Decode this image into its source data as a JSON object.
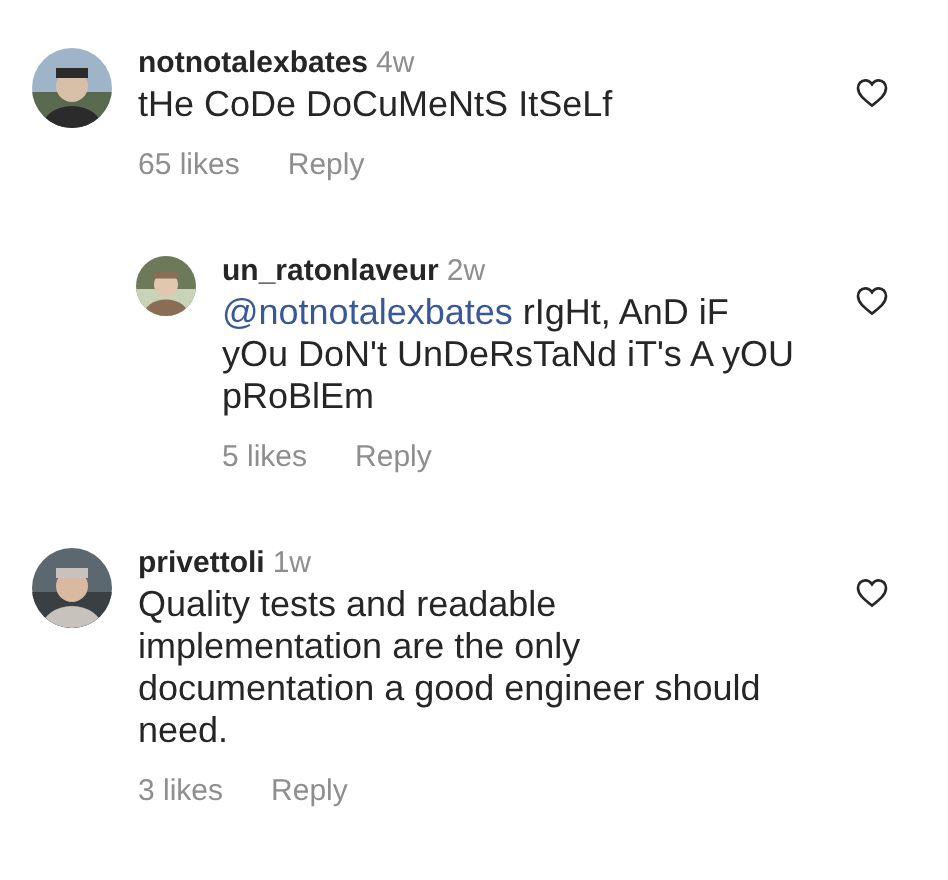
{
  "comments": [
    {
      "username": "notnotalexbates",
      "time": "4w",
      "text": "tHe CoDe DoCuMeNtS ItSeLf",
      "likes": "65 likes",
      "reply": "Reply",
      "liked": false,
      "avatar": {
        "kind": "picture"
      },
      "children": [
        {
          "username": "un_ratonlaveur",
          "time": "2w",
          "mention": "@notnotalexbates",
          "text": "rIgHt, AnD iF yOu DoN't UnDeRsTaNd iT's A yOU pRoBlEm",
          "likes": "5 likes",
          "reply": "Reply",
          "liked": false,
          "avatar": {
            "kind": "picture"
          }
        }
      ]
    },
    {
      "username": "privettoli",
      "time": "1w",
      "text": "Quality tests and readable implementation are the only documentation a good engineer should need.",
      "likes": "3 likes",
      "reply": "Reply",
      "liked": false,
      "avatar": {
        "kind": "picture"
      }
    }
  ]
}
